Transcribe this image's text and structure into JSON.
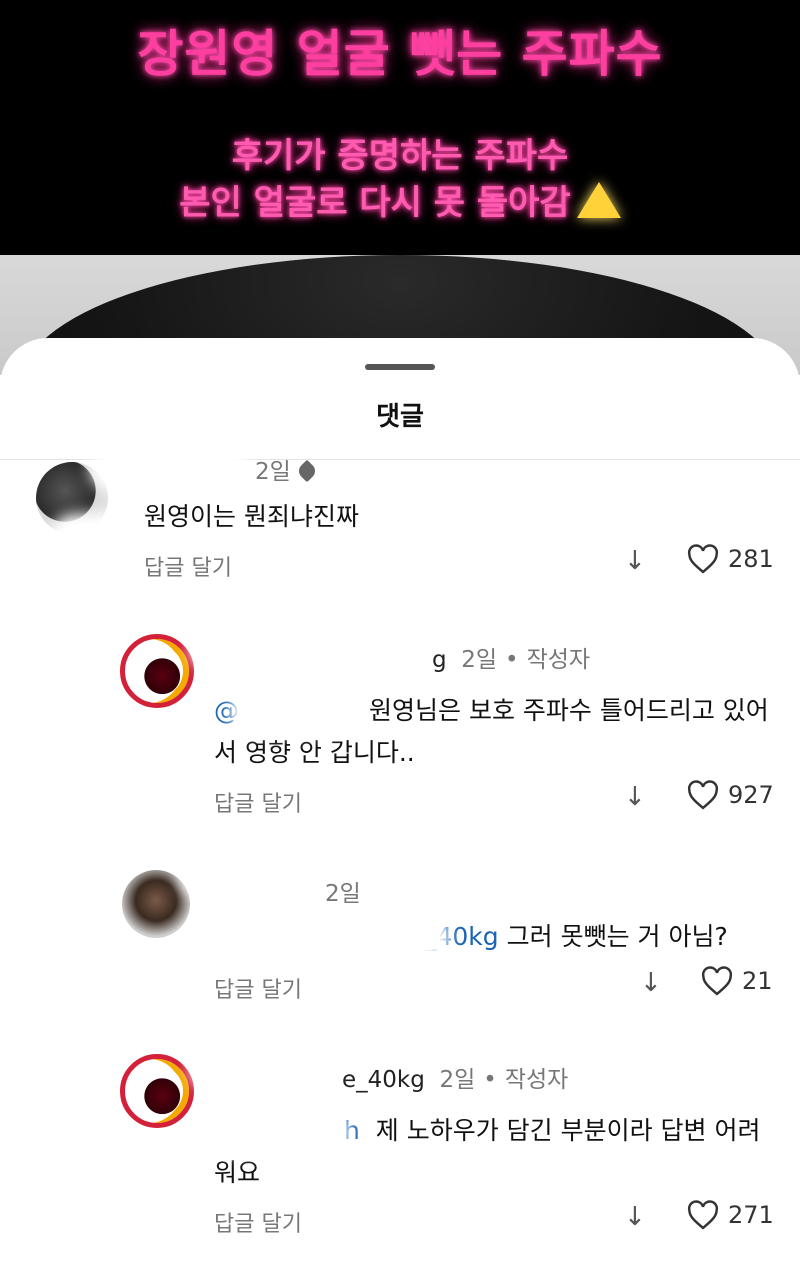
{
  "banner": {
    "title": "장원영 얼굴 뺏는 주파수",
    "line1": "후기가 증명하는 주파수",
    "line2": "본인 얼굴로 다시 못 돌아감"
  },
  "sheet": {
    "title": "댓글"
  },
  "comments": [
    {
      "time": "2일",
      "text": "원영이는 뭔죄냐진짜",
      "reply": "답글 달기",
      "likes": "281"
    },
    {
      "user_tail": "g",
      "time": "2일",
      "author": "작성자",
      "mention": "@",
      "text": "원영님은 보호 주파수 틀어드리고 있어서 영향 안 갑니다..",
      "reply": "답글 달기",
      "likes": "927"
    },
    {
      "time": "2일",
      "mention": "_40kg",
      "text": "그러 못뺏는 거 아님?",
      "reply": "답글 달기",
      "likes": "21"
    },
    {
      "user_tail": "e_40kg",
      "time": "2일",
      "author": "작성자",
      "mention": "h",
      "text": "제 노하우가 담긴 부분이라 답변 어려워요",
      "reply": "답글 달기",
      "likes": "271"
    }
  ]
}
